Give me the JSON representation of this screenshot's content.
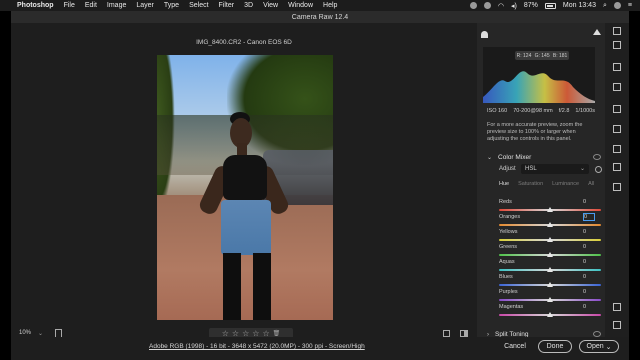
{
  "menubar": {
    "app": "Photoshop",
    "items": [
      "File",
      "Edit",
      "Image",
      "Layer",
      "Type",
      "Select",
      "Filter",
      "3D",
      "View",
      "Window",
      "Help"
    ],
    "battery": "87%",
    "battery_level": 0.87,
    "clock": "Mon 13:43",
    "icons": [
      "apple-icon",
      "notification-icon",
      "sync-icon",
      "wifi-icon",
      "volume-icon",
      "search-icon",
      "siri-icon",
      "list-icon"
    ]
  },
  "window": {
    "title": "Camera Raw 12.4",
    "filename": "IMG_8400.CR2  -  Canon EOS 6D"
  },
  "bottombar": {
    "zoom": "10%",
    "stars": [
      "☆",
      "☆",
      "☆",
      "☆",
      "☆"
    ],
    "trash": "🗑"
  },
  "footer": {
    "info": "Adobe RGB (1998) - 16 bit - 3648 x 5472 (20.0MP) - 300 ppi - Screen/High",
    "cancel": "Cancel",
    "done": "Done",
    "open": "Open"
  },
  "panel": {
    "rgb": {
      "r": "R: 124",
      "g": "G: 145",
      "b": "B: 181"
    },
    "exif": {
      "iso": "ISO 160",
      "lens": "70-200@98 mm",
      "aperture": "f/2.8",
      "shutter": "1/1000s"
    },
    "hint_lines": [
      "For a more accurate preview, zoom the",
      "preview size to 100% or larger when",
      "adjusting the controls in this panel."
    ],
    "color_mixer": {
      "title": "Color Mixer",
      "adjust_label": "Adjust",
      "adjust_value": "HSL",
      "tabs": [
        "Hue",
        "Saturation",
        "Luminance",
        "All"
      ],
      "active_tab": "Hue",
      "sliders": [
        {
          "label": "Reds",
          "value": "0",
          "position": 0.5,
          "color": "#e04a3a"
        },
        {
          "label": "Oranges",
          "value": "0",
          "position": 0.5,
          "color": "#e58a2f",
          "selected": true
        },
        {
          "label": "Yellows",
          "value": "0",
          "position": 0.5,
          "color": "#d9cf3a"
        },
        {
          "label": "Greens",
          "value": "0",
          "position": 0.5,
          "color": "#4fc24a"
        },
        {
          "label": "Aquas",
          "value": "0",
          "position": 0.5,
          "color": "#3ec3c4"
        },
        {
          "label": "Blues",
          "value": "0",
          "position": 0.5,
          "color": "#3a64d6"
        },
        {
          "label": "Purples",
          "value": "0",
          "position": 0.5,
          "color": "#8a4cc9"
        },
        {
          "label": "Magentas",
          "value": "0",
          "position": 0.5,
          "color": "#c948a8"
        }
      ]
    },
    "split_toning": "Split Toning"
  },
  "tools": [
    "crop-icon",
    "brush-icon",
    "spot-heal-icon",
    "redeye-icon",
    "gradient-icon",
    "radial-icon",
    "presets-icon",
    "snapshot-icon",
    "more-icon"
  ]
}
